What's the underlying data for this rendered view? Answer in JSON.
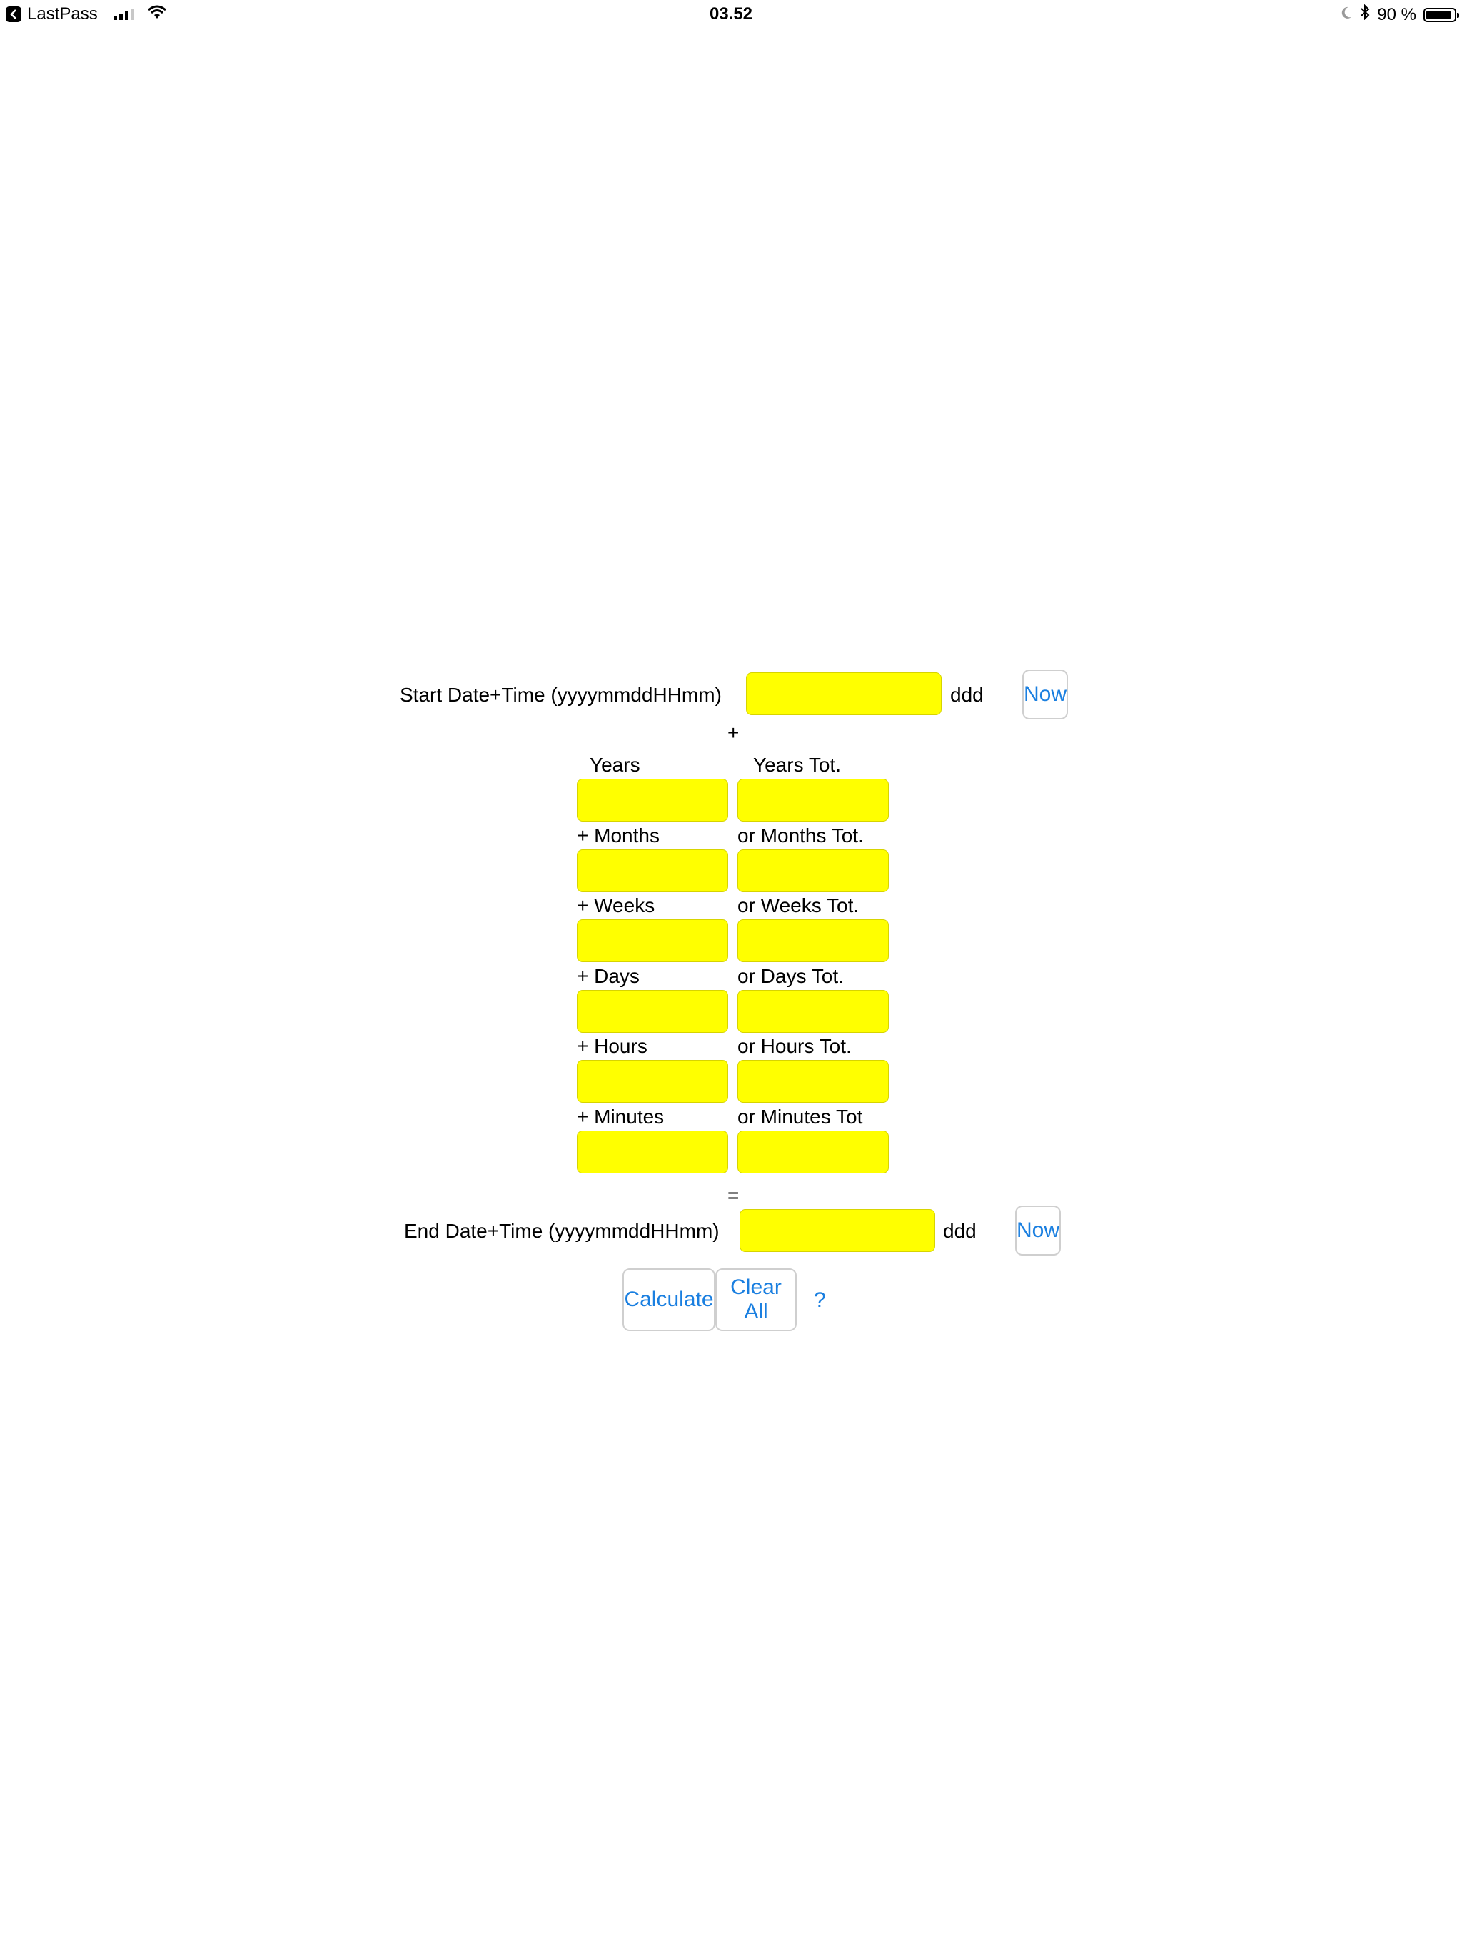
{
  "status_bar": {
    "back_app": "LastPass",
    "time": "03.52",
    "battery_percent": "90 %",
    "battery_level": 0.9
  },
  "form": {
    "start_label": "Start Date+Time (yyyymmddHHmm)",
    "start_day": "ddd",
    "now_label": "Now",
    "plus_sign": "+",
    "equals_sign": "=",
    "end_label": "End Date+Time (yyyymmddHHmm)",
    "end_day": "ddd",
    "rows": [
      {
        "left_label": "Years",
        "right_label": "Years Tot."
      },
      {
        "left_label": "+ Months",
        "right_label": "or Months Tot."
      },
      {
        "left_label": "+ Weeks",
        "right_label": "or Weeks Tot."
      },
      {
        "left_label": "+ Days",
        "right_label": "or Days Tot."
      },
      {
        "left_label": "+ Hours",
        "right_label": "or Hours Tot."
      },
      {
        "left_label": "+ Minutes",
        "right_label": "or Minutes Tot"
      }
    ]
  },
  "actions": {
    "calculate": "Calculate",
    "clear_all": "Clear All",
    "help": "?"
  },
  "colors": {
    "field_bg": "#ffff00",
    "link": "#1a7fe0"
  }
}
